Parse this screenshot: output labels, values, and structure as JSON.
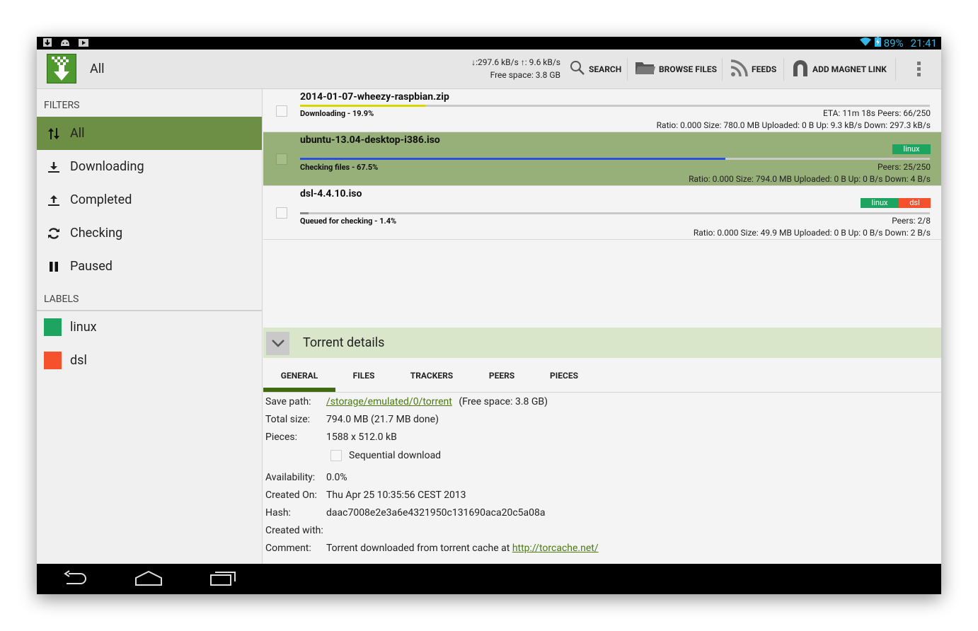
{
  "status_bar": {
    "battery": "89%",
    "time": "21:41"
  },
  "action_bar": {
    "title": "All",
    "speed_line": "↓:297.6 kB/s ↑: 9.6 kB/s",
    "free_space": "Free space: 3.8 GB",
    "search_label": "SEARCH",
    "browse_label": "BROWSE FILES",
    "feeds_label": "FEEDS",
    "magnet_label": "ADD MAGNET LINK"
  },
  "sidebar": {
    "filters_header": "FILTERS",
    "filters": [
      {
        "label": "All",
        "icon": "up-down-arrows-icon",
        "active": true
      },
      {
        "label": "Downloading",
        "icon": "download-icon"
      },
      {
        "label": "Completed",
        "icon": "upload-icon"
      },
      {
        "label": "Checking",
        "icon": "refresh-icon"
      },
      {
        "label": "Paused",
        "icon": "pause-icon"
      }
    ],
    "labels_header": "LABELS",
    "labels": [
      {
        "label": "linux",
        "color": "#1da460"
      },
      {
        "label": "dsl",
        "color": "#f4512c"
      }
    ]
  },
  "torrents": [
    {
      "name": "2014-01-07-wheezy-raspbian.zip",
      "status": "Downloading - 19.9%",
      "progress": 0.199,
      "bar_color": "#d6d600",
      "line1_right": "ETA: 11m 18s   Peers: 66/250",
      "line2_right": "Ratio: 0.000   Size: 780.0 MB   Uploaded: 0 B    Up: 9.3 kB/s   Down: 297.3 kB/s",
      "labels": []
    },
    {
      "name": "ubuntu-13.04-desktop-i386.iso",
      "status": "Checking files - 67.5%",
      "progress": 0.675,
      "bar_color": "#2b4fe0",
      "line1_right": "Peers: 25/250",
      "line2_right": "Ratio: 0.000   Size: 794.0 MB   Uploaded: 0 B    Up: 0 B/s   Down: 4 B/s",
      "labels": [
        "linux"
      ],
      "selected": true
    },
    {
      "name": "dsl-4.4.10.iso",
      "status": "Queued for checking - 1.4%",
      "progress": 0.014,
      "bar_color": "#888888",
      "line1_right": "Peers: 2/8",
      "line2_right": "Ratio: 0.000   Size: 49.9 MB   Uploaded: 0 B    Up: 0 B/s   Down: 2 B/s",
      "labels": [
        "linux",
        "dsl"
      ]
    }
  ],
  "details": {
    "title": "Torrent details",
    "tabs": [
      "GENERAL",
      "FILES",
      "TRACKERS",
      "PEERS",
      "PIECES"
    ],
    "active_tab": "GENERAL",
    "general": {
      "save_path_label": "Save path:",
      "save_path": "/storage/emulated/0/torrent",
      "save_path_free": "(Free space: 3.8 GB)",
      "total_size_label": "Total size:",
      "total_size": "794.0 MB (21.7 MB done)",
      "pieces_label": "Pieces:",
      "pieces": "1588 x 512.0 kB",
      "sequential_label": "Sequential download",
      "availability_label": "Availability:",
      "availability": "0.0%",
      "created_on_label": "Created On:",
      "created_on": "Thu Apr 25 10:35:56 CEST 2013",
      "hash_label": "Hash:",
      "hash": "daac7008e2e3a6e4321950c131690aca20c5a08a",
      "created_with_label": "Created with:",
      "created_with": "",
      "comment_label": "Comment:",
      "comment_text": "Torrent downloaded from torrent cache at ",
      "comment_link": "http://torcache.net/"
    }
  },
  "colors": {
    "accent": "#6c8e45",
    "selected_row": "#97af78",
    "details_header": "#d9e6c9",
    "tab_indicator": "#3f6a12",
    "link": "#4b7a13"
  }
}
